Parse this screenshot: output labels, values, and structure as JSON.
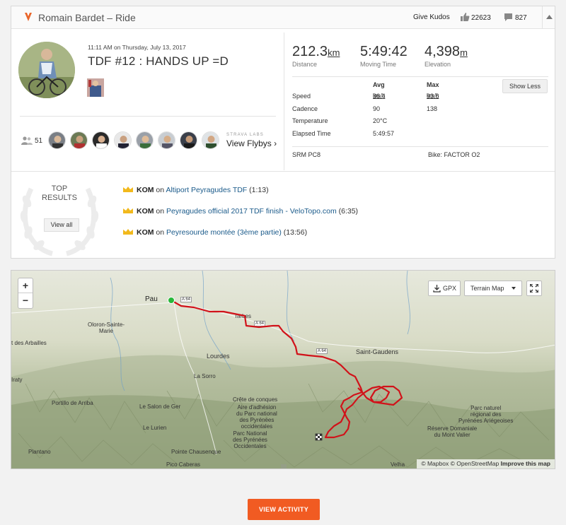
{
  "header": {
    "title": "Romain Bardet – Ride",
    "give_kudos": "Give Kudos",
    "kudos_count": "22623",
    "comment_count": "827"
  },
  "activity": {
    "datetime": "11:11 AM on Thursday, July 13, 2017",
    "title": "TDF #12 : HANDS UP =D"
  },
  "headline_stats": [
    {
      "value": "212.3",
      "unit": "km",
      "label": "Distance"
    },
    {
      "value": "5:49:42",
      "unit": "",
      "label": "Moving Time"
    },
    {
      "value": "4,398",
      "unit": "m",
      "label": "Elevation"
    }
  ],
  "stats_table": {
    "avg_header": "Avg",
    "max_header": "Max",
    "show_less": "Show Less",
    "rows": [
      {
        "label": "Speed",
        "avg": "36.4",
        "avg_unit": "km/h",
        "max": "93.6",
        "max_unit": "km/h"
      },
      {
        "label": "Cadence",
        "avg": "90",
        "avg_unit": "",
        "max": "138",
        "max_unit": ""
      },
      {
        "label": "Temperature",
        "avg": "20°C",
        "avg_unit": "",
        "max": "",
        "max_unit": ""
      },
      {
        "label": "Elapsed Time",
        "avg": "5:49:57",
        "avg_unit": "",
        "max": "",
        "max_unit": ""
      }
    ],
    "device": "SRM PC8",
    "bike": "Bike: FACTOR O2"
  },
  "flyby": {
    "athlete_count": "51",
    "labs": "STRAVA LABS",
    "link": "View Flybys"
  },
  "top_results": {
    "title_line1": "TOP",
    "title_line2": "RESULTS",
    "view_all": "View all",
    "items": [
      {
        "badge": "KOM",
        "on": "on",
        "segment": "Altiport Peyragudes TDF",
        "time": "(1:13)"
      },
      {
        "badge": "KOM",
        "on": "on",
        "segment": "Peyragudes official 2017 TDF finish - VeloTopo.com",
        "time": "(6:35)"
      },
      {
        "badge": "KOM",
        "on": "on",
        "segment": "Peyresourde montée (3ème partie)",
        "time": "(13:56)"
      }
    ]
  },
  "map": {
    "zoom_in": "+",
    "zoom_out": "−",
    "gpx": "GPX",
    "map_type": "Terrain Map",
    "attribution_mapbox": "© Mapbox",
    "attribution_osm": "© OpenStreetMap",
    "attribution_improve": "Improve this map",
    "labels": {
      "pau": "Pau",
      "a64_1": "A 64",
      "a64_2": "A 64",
      "a64_3": "A 64",
      "tarbes": "Tarbes",
      "oloron": "Oloron-Sainte-Marie",
      "arbailles": "t des Arbailles",
      "lourdes": "Lourdes",
      "saint_gaudens": "Saint-Gaudens",
      "la_sorro": "La Sorro",
      "irraty": "Iraty",
      "portillo": "Portillo de Arriba",
      "salon": "Le Salon de Ger",
      "lurien": "Le Lurien",
      "crete": "Crête de conques",
      "aire1": "Aire d'adhésion",
      "aire2": "du Parc national",
      "aire3": "des Pyrénées",
      "aire4": "occidentales",
      "parc1": "Parc National",
      "parc2": "des Pyrénées",
      "parc3": "Occidentales",
      "pnr1": "Parc naturel",
      "pnr2": "régional des",
      "pnr3": "Pyrénées Ariégeoises",
      "reserve1": "Réserve Domaniale",
      "reserve2": "du Mont Valier",
      "plantano": "Plantano",
      "pointe": "Pointe Chausenque",
      "pico": "Pico Caberas",
      "velha": "Velha"
    }
  },
  "cta": {
    "label": "VIEW ACTIVITY"
  },
  "colors": {
    "accent": "#f15b22",
    "route": "#d1121a",
    "link": "#1a5a8a",
    "crown": "#f2b91c"
  }
}
